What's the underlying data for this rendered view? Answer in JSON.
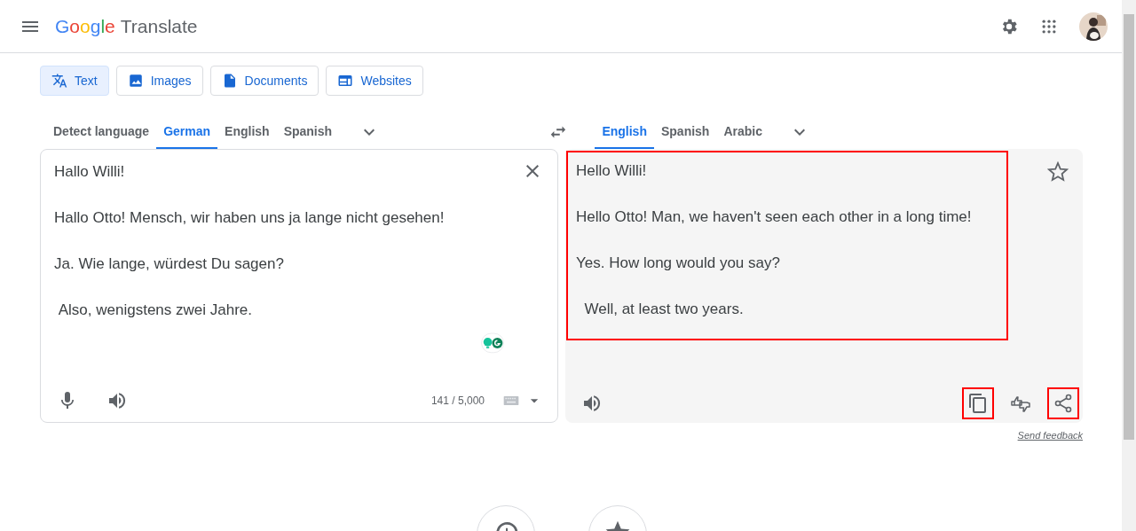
{
  "header": {
    "logo_brand": "Google",
    "logo_product": "Translate"
  },
  "modes": [
    {
      "label": "Text",
      "kind": "text",
      "selected": true
    },
    {
      "label": "Images",
      "kind": "images",
      "selected": false
    },
    {
      "label": "Documents",
      "kind": "documents",
      "selected": false
    },
    {
      "label": "Websites",
      "kind": "websites",
      "selected": false
    }
  ],
  "source_languages": [
    {
      "label": "Detect language",
      "selected": false
    },
    {
      "label": "German",
      "selected": true
    },
    {
      "label": "English",
      "selected": false
    },
    {
      "label": "Spanish",
      "selected": false
    }
  ],
  "target_languages": [
    {
      "label": "English",
      "selected": true
    },
    {
      "label": "Spanish",
      "selected": false
    },
    {
      "label": "Arabic",
      "selected": false
    }
  ],
  "source": {
    "paragraphs": [
      "Hallo Willi!",
      "Hallo Otto! Mensch, wir haben uns ja lange nicht gesehen!",
      "Ja. Wie lange, würdest Du sagen?",
      " Also, wenigstens zwei Jahre."
    ],
    "char_count": "141 / 5,000"
  },
  "output": {
    "highlighted": true,
    "paragraphs": [
      "Hello Willi!",
      "Hello Otto! Man, we haven't seen each other in a long time!",
      "Yes. How long would you say?",
      "  Well, at least two years."
    ],
    "actions": [
      {
        "kind": "copy",
        "highlighted": true
      },
      {
        "kind": "rate",
        "highlighted": false
      },
      {
        "kind": "share",
        "highlighted": true
      }
    ]
  },
  "feedback_link": "Send feedback"
}
